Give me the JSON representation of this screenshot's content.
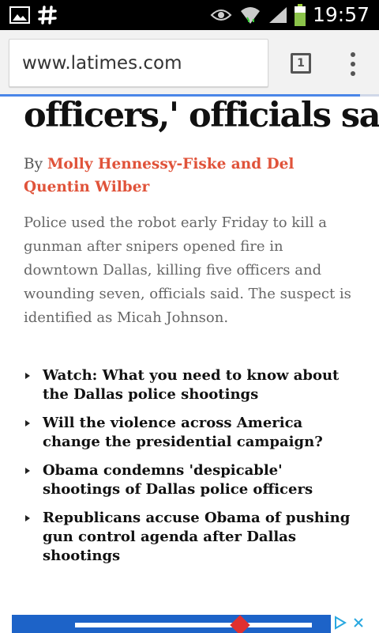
{
  "statusbar": {
    "time": "19:57",
    "icons": [
      "image-icon",
      "slack-icon",
      "eye-icon",
      "wifi-icon",
      "signal-icon",
      "battery-icon"
    ]
  },
  "browser": {
    "url": "www.latimes.com",
    "tab_count": "1",
    "load_progress": 0.95,
    "accent": "#4a86e8"
  },
  "article": {
    "headline": "officers,' officials say",
    "byline_prefix": "By ",
    "authors": "Molly Hennessy-Fiske and Del Quentin Wilber",
    "summary": "Police used the robot early Friday to kill a gunman after snipers opened fire in downtown Dallas, killing five officers and wounding seven, officials said. The suspect is identified as Micah Johnson.",
    "author_color": "#e0533a"
  },
  "related": [
    {
      "label": "Watch: What you need to know about the Dallas police shootings"
    },
    {
      "label": "Will the violence across America change the presidential campaign?"
    },
    {
      "label": "Obama condemns 'despicable' shootings of Dallas police officers"
    },
    {
      "label": "Republicans accuse Obama of pushing gun control agenda after Dallas shootings"
    }
  ],
  "ad": {
    "brand_color": "#1d63c8",
    "icons": [
      "adchoices-icon",
      "close-icon"
    ]
  }
}
